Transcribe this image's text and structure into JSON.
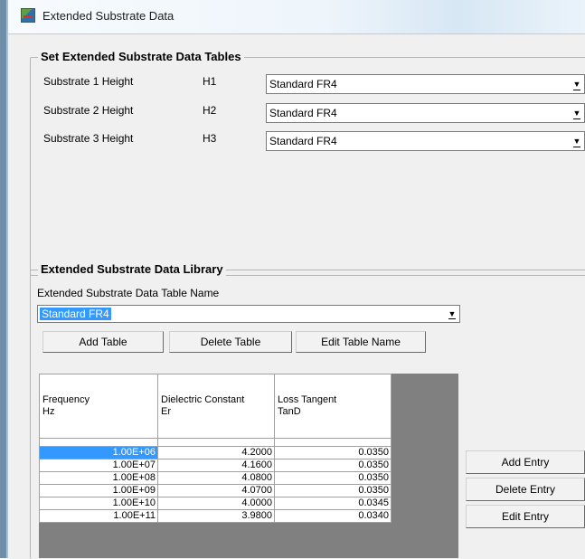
{
  "window": {
    "title": "Extended Substrate Data"
  },
  "tables_group": {
    "title": "Set Extended Substrate Data Tables",
    "rows": [
      {
        "label": "Substrate 1 Height",
        "param": "H1",
        "value": "Standard FR4"
      },
      {
        "label": "Substrate 2 Height",
        "param": "H2",
        "value": "Standard FR4"
      },
      {
        "label": "Substrate 3 Height",
        "param": "H3",
        "value": "Standard FR4"
      }
    ]
  },
  "library_group": {
    "title": "Extended Substrate Data Library",
    "name_label": "Extended Substrate Data Table Name",
    "name_value": "Standard FR4",
    "buttons": {
      "add_table": "Add Table",
      "delete_table": "Delete Table",
      "edit_table_name": "Edit Table Name"
    },
    "columns": [
      {
        "line1": "Frequency",
        "line2": "Hz"
      },
      {
        "line1": "Dielectric Constant",
        "line2": "Er"
      },
      {
        "line1": "Loss Tangent",
        "line2": "TanD"
      }
    ],
    "rows": [
      {
        "freq": "1.00E+06",
        "er": "4.2000",
        "tand": "0.0350"
      },
      {
        "freq": "1.00E+07",
        "er": "4.1600",
        "tand": "0.0350"
      },
      {
        "freq": "1.00E+08",
        "er": "4.0800",
        "tand": "0.0350"
      },
      {
        "freq": "1.00E+09",
        "er": "4.0700",
        "tand": "0.0350"
      },
      {
        "freq": "1.00E+10",
        "er": "4.0000",
        "tand": "0.0345"
      },
      {
        "freq": "1.00E+11",
        "er": "3.9800",
        "tand": "0.0340"
      }
    ],
    "entry_buttons": {
      "add": "Add Entry",
      "delete": "Delete Entry",
      "edit": "Edit Entry"
    }
  }
}
